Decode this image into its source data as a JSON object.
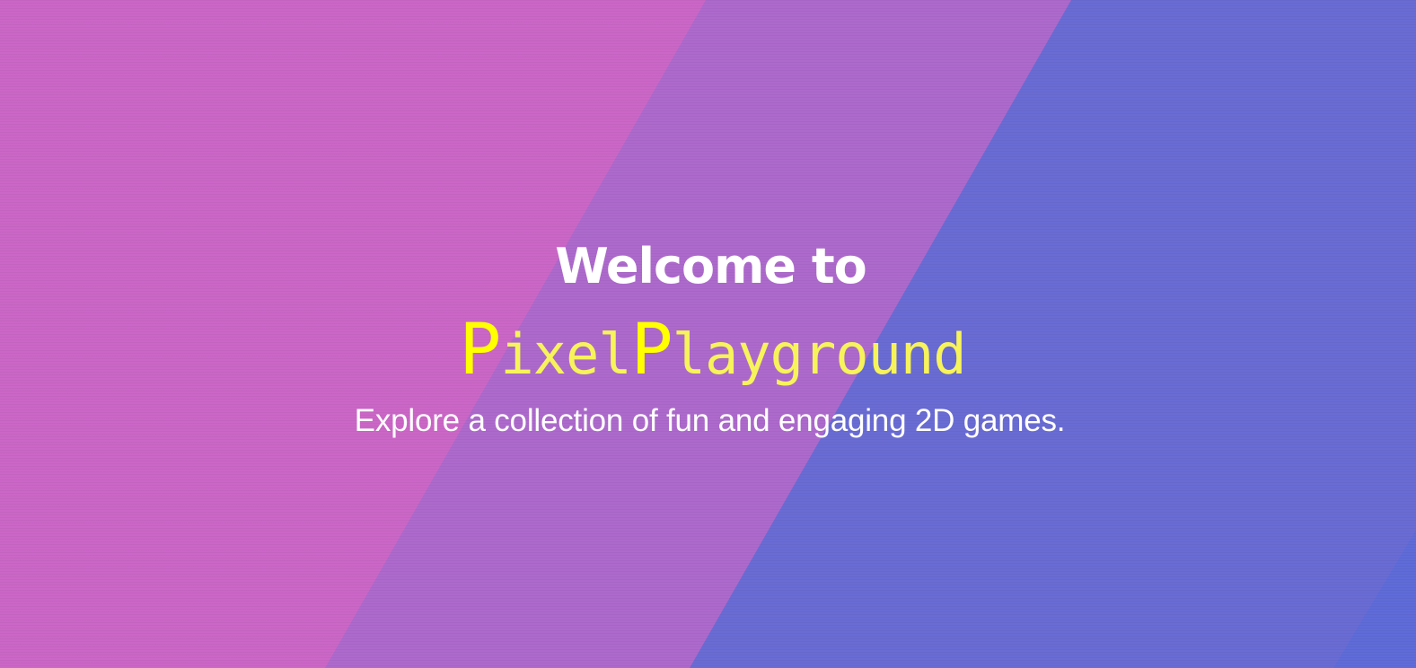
{
  "hero": {
    "heading": "Welcome to",
    "brand": {
      "first_cap": "P",
      "first_rest": "ixel",
      "second_cap": "P",
      "second_rest": "layground"
    },
    "tagline": "Explore a collection of fun and engaging 2D games."
  },
  "colors": {
    "band_magenta": "#cb67c7",
    "band_violet": "#ad6acc",
    "band_indigo": "#6a6cd4",
    "band_blue": "#5f6cd8",
    "heading_text": "#ffffff",
    "brand_text": "#f7f35a",
    "brand_cap": "#ffff00"
  }
}
